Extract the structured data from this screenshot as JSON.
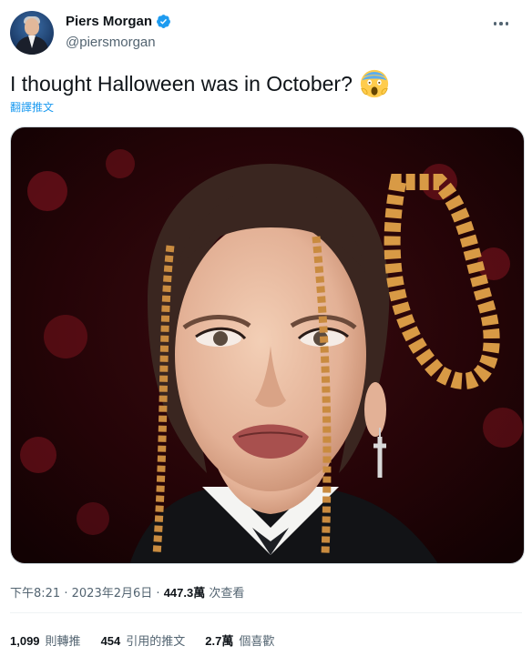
{
  "author": {
    "name": "Piers Morgan",
    "handle": "@piersmorgan",
    "verified": true,
    "verified_color": "#1d9bf0"
  },
  "tweet": {
    "text": "I thought Halloween was in October?",
    "emoji": "face-screaming-in-fear",
    "translate_label": "翻譯推文"
  },
  "media": {
    "type": "photo",
    "icon": "photo"
  },
  "meta": {
    "time": "下午8:21",
    "separator1": "·",
    "date": "2023年2月6日",
    "separator2": "·",
    "views_count": "447.3萬",
    "views_label": "次查看"
  },
  "stats": {
    "retweets_count": "1,099",
    "retweets_label": "則轉推",
    "quotes_count": "454",
    "quotes_label": "引用的推文",
    "likes_count": "2.7萬",
    "likes_label": "個喜歡"
  },
  "colors": {
    "text": "#0f1419",
    "secondary": "#536471",
    "link": "#1d9bf0",
    "border": "#eff3f4"
  }
}
